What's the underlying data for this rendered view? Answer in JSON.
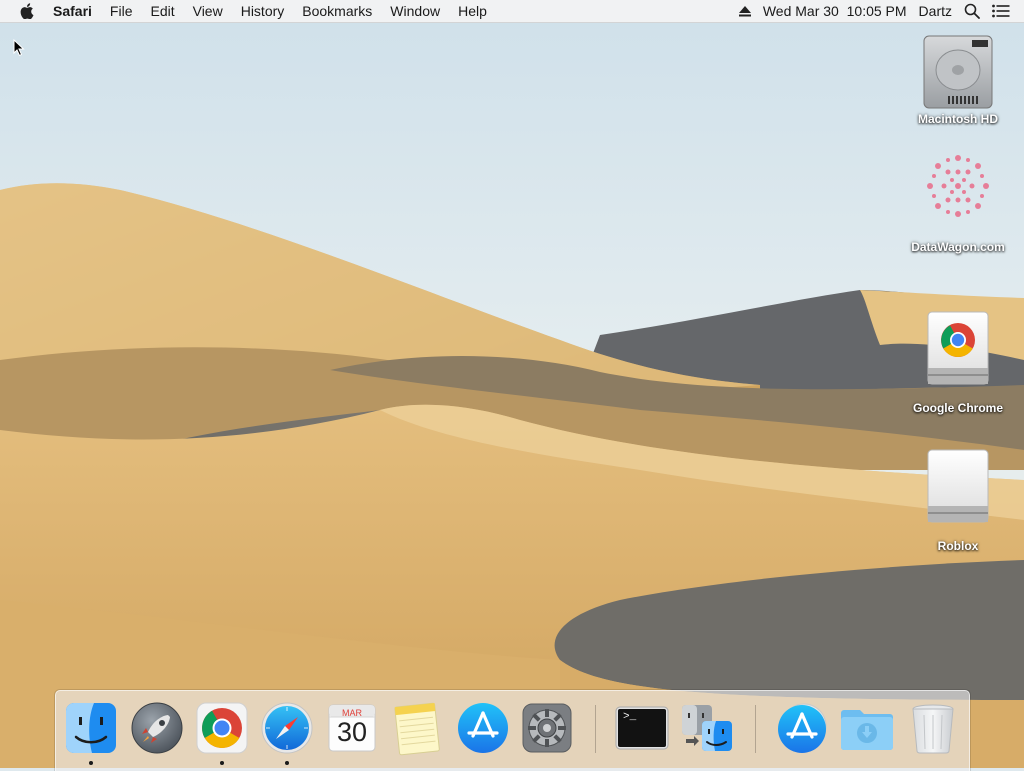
{
  "menubar": {
    "app_name": "Safari",
    "menus": [
      "File",
      "Edit",
      "View",
      "History",
      "Bookmarks",
      "Window",
      "Help"
    ],
    "clock": "Wed Mar 30  10:05 PM",
    "user": "Dartz",
    "icons": [
      "apple-icon",
      "eject-icon",
      "spotlight-search-icon",
      "notification-center-icon"
    ]
  },
  "desktop": {
    "icons": [
      {
        "label": "Macintosh HD",
        "icon": "hard-drive-icon"
      },
      {
        "label": "DataWagon.com",
        "icon": "pink-flower-image-icon"
      },
      {
        "label": "Google Chrome",
        "icon": "chrome-installer-disk-icon"
      },
      {
        "label": "Roblox",
        "icon": "external-disk-icon"
      }
    ]
  },
  "dock": {
    "items": [
      {
        "name": "Finder",
        "icon": "finder-icon",
        "running": true
      },
      {
        "name": "Launchpad",
        "icon": "launchpad-rocket-icon",
        "running": false
      },
      {
        "name": "Google Chrome",
        "icon": "chrome-icon",
        "running": true
      },
      {
        "name": "Safari",
        "icon": "safari-compass-icon",
        "running": true
      },
      {
        "name": "Calendar",
        "icon": "calendar-icon",
        "running": false,
        "month": "MAR",
        "day": "30"
      },
      {
        "name": "Notes",
        "icon": "notes-icon",
        "running": false
      },
      {
        "name": "App Store",
        "icon": "app-store-icon",
        "running": false
      },
      {
        "name": "System Preferences",
        "icon": "gear-icon",
        "running": false
      },
      {
        "name": "Terminal",
        "icon": "terminal-icon",
        "running": false,
        "prompt": ">_"
      },
      {
        "name": "Migration Assistant",
        "icon": "migration-assistant-icon",
        "running": false
      },
      {
        "name": "Downloads stack",
        "icon": "app-store-stack-icon",
        "running": false
      },
      {
        "name": "Downloads folder",
        "icon": "downloads-folder-icon",
        "running": false
      },
      {
        "name": "Trash",
        "icon": "trash-icon",
        "running": false
      }
    ]
  },
  "colors": {
    "menubar_bg": "#f3f3f3",
    "sky": "#dfeaf0",
    "sand": "#dcb676",
    "shadow_dune": "#6c6a66",
    "dock_bg": "#ececee"
  }
}
